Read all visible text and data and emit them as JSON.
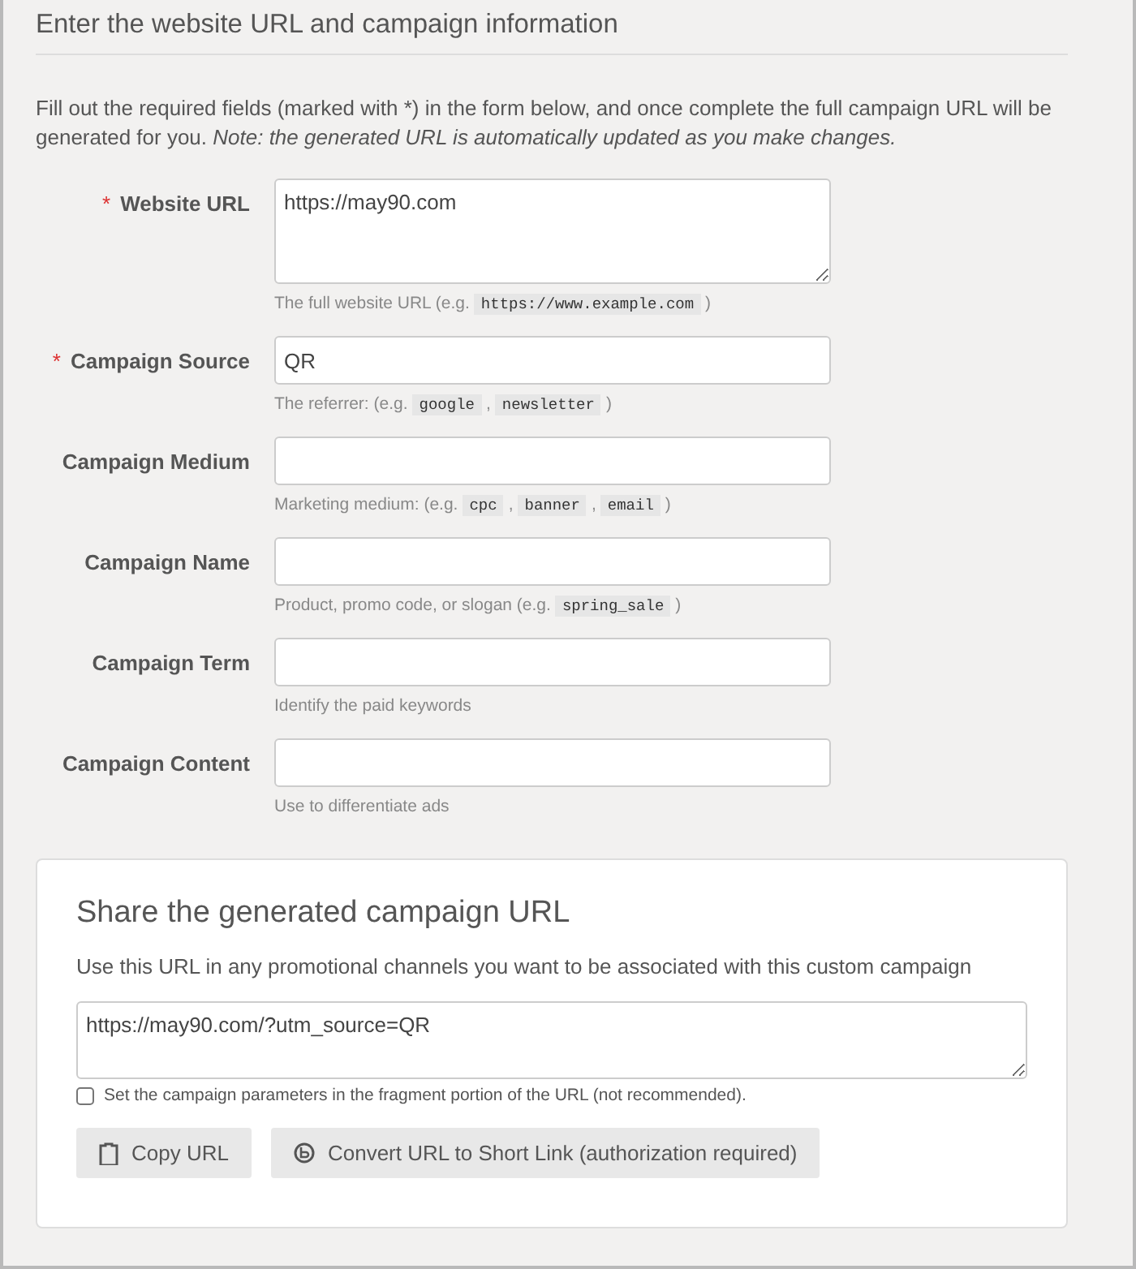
{
  "section_title": "Enter the website URL and campaign information",
  "intro": "Fill out the required fields (marked with *) in the form below, and once complete the full campaign URL will be generated for you. *Note: the generated URL is automatically updated as you make changes.*",
  "fields": [
    {
      "label": "Website URL",
      "required_mark": "*",
      "kind": "textarea",
      "value": "https://may90.com",
      "help": [
        {
          "kind": "text",
          "text": "The full website URL (e.g."
        },
        {
          "kind": "code",
          "text": "https://www.example.com"
        },
        {
          "kind": "text",
          "text": ")"
        }
      ]
    },
    {
      "label": "Campaign Source",
      "required_mark": "*",
      "kind": "input",
      "value": "QR",
      "help": [
        {
          "kind": "text",
          "text": "The referrer: (e.g."
        },
        {
          "kind": "code",
          "text": "google"
        },
        {
          "kind": "text",
          "text": ","
        },
        {
          "kind": "code",
          "text": "newsletter"
        },
        {
          "kind": "text",
          "text": ")"
        }
      ]
    },
    {
      "label": "Campaign Medium",
      "kind": "input",
      "help": [
        {
          "kind": "text",
          "text": "Marketing medium: (e.g."
        },
        {
          "kind": "code",
          "text": "cpc"
        },
        {
          "kind": "text",
          "text": ","
        },
        {
          "kind": "code",
          "text": "banner"
        },
        {
          "kind": "text",
          "text": ","
        },
        {
          "kind": "code",
          "text": "email"
        },
        {
          "kind": "text",
          "text": ")"
        }
      ]
    },
    {
      "label": "Campaign Name",
      "kind": "input",
      "help": [
        {
          "kind": "text",
          "text": "Product, promo code, or slogan (e.g."
        },
        {
          "kind": "code",
          "text": "spring_sale"
        },
        {
          "kind": "text",
          "text": ")"
        }
      ]
    },
    {
      "label": "Campaign Term",
      "kind": "input",
      "help": [
        {
          "kind": "text",
          "text": "Identify the paid keywords"
        }
      ]
    },
    {
      "label": "Campaign Content",
      "kind": "input",
      "help": [
        {
          "kind": "text",
          "text": "Use to differentiate ads"
        }
      ]
    }
  ],
  "share": {
    "title": "Share the generated campaign URL",
    "description": "Use this URL in any promotional channels you want to be associated with this custom campaign",
    "generated_url": "https://may90.com/?utm_source=QR",
    "fragment_option": {
      "label": "Set the campaign parameters in the fragment portion of the URL (not recommended).",
      "checked": false
    },
    "buttons": [
      {
        "label": "Copy URL",
        "kind": "copy"
      },
      {
        "label": "Convert URL to Short Link (authorization required)",
        "kind": "shorten"
      }
    ]
  }
}
